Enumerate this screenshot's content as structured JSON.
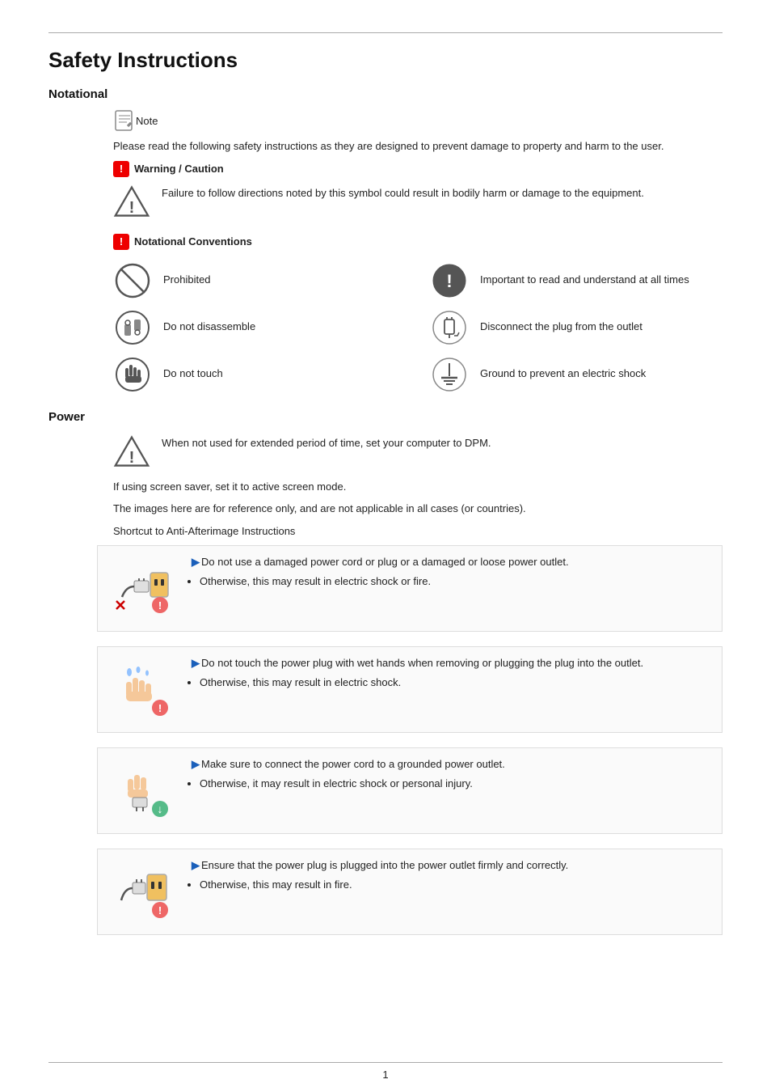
{
  "page": {
    "title": "Safety Instructions",
    "page_number": "1"
  },
  "notational": {
    "section_title": "Notational",
    "note_label": "Note",
    "note_paragraph": "Please read the following safety instructions as they are designed to prevent damage to property and harm to the user.",
    "warning_label": "Warning / Caution",
    "caution_text": "Failure to follow directions noted by this symbol could result in bodily harm or damage to the equipment.",
    "notational_conv_title": "Notational Conventions",
    "conventions": [
      {
        "icon_type": "prohibited",
        "label": "Prohibited"
      },
      {
        "icon_type": "important",
        "label": "Important to read and understand at all times"
      },
      {
        "icon_type": "disassemble",
        "label": "Do not disassemble"
      },
      {
        "icon_type": "disconnect",
        "label": "Disconnect the plug from the outlet"
      },
      {
        "icon_type": "notouch",
        "label": "Do not touch"
      },
      {
        "icon_type": "ground",
        "label": "Ground to prevent an electric shock"
      }
    ]
  },
  "power": {
    "section_title": "Power",
    "triangle_text1": "When not used for extended period of time, set your computer to DPM.",
    "triangle_text2": "If using screen saver, set it to active screen mode.",
    "triangle_text3": "The images here are for reference only, and are not applicable in all cases (or countries).",
    "triangle_text4": "Shortcut to Anti-Afterimage Instructions",
    "items": [
      {
        "img_type": "power_cord",
        "text": "Do not use a damaged power cord or plug or a damaged or loose power outlet.",
        "bullet": "Otherwise, this may result in electric shock or fire."
      },
      {
        "img_type": "wet_hands",
        "text": "Do not touch the power plug with wet hands when removing or plugging the plug into the outlet.",
        "bullet": "Otherwise, this may result in electric shock."
      },
      {
        "img_type": "grounded",
        "text": "Make sure to connect the power cord to a grounded power outlet.",
        "bullet": "Otherwise, it may result in electric shock or personal injury."
      },
      {
        "img_type": "firmly",
        "text": "Ensure that the power plug is plugged into the power outlet firmly and correctly.",
        "bullet": "Otherwise, this may result in fire."
      }
    ]
  }
}
